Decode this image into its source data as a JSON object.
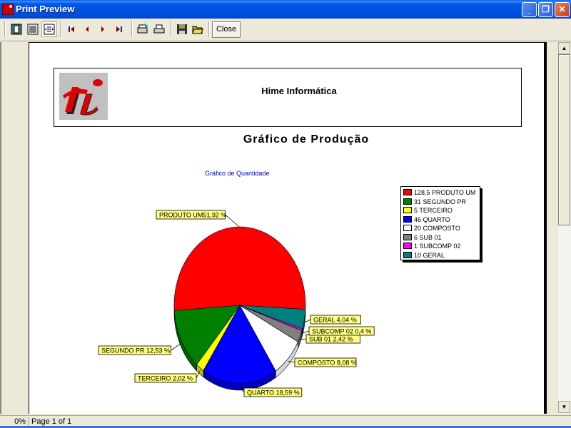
{
  "window": {
    "title": "Print Preview",
    "controls": [
      "minimize",
      "restore",
      "close"
    ]
  },
  "toolbar": {
    "buttons": [
      {
        "name": "whole-page",
        "icon": "whole-page-icon"
      },
      {
        "name": "page-width",
        "icon": "page-width-icon"
      },
      {
        "name": "zoom-100",
        "icon": "zoom-100-icon",
        "pressed": true
      },
      {
        "name": "first-page",
        "icon": "first-page-icon"
      },
      {
        "name": "prior-page",
        "icon": "prior-page-icon"
      },
      {
        "name": "next-page",
        "icon": "next-page-icon"
      },
      {
        "name": "last-page",
        "icon": "last-page-icon"
      },
      {
        "name": "printer-setup",
        "icon": "printer-setup-icon"
      },
      {
        "name": "print",
        "icon": "print-icon"
      },
      {
        "name": "save",
        "icon": "save-icon"
      },
      {
        "name": "open",
        "icon": "open-folder-icon"
      }
    ],
    "close_label": "Close"
  },
  "report": {
    "company": "Hime Informática",
    "title": "Gráfico de Produção"
  },
  "chart_data": {
    "type": "pie",
    "title": "Gráfico de Quantidade",
    "legend_position": "top-right",
    "slices": [
      {
        "name": "PRODUTO UM",
        "value": 128.5,
        "percent": 51.92,
        "label": "PRODUTO UM51,92 %",
        "legend": "128,5 PRODUTO UM",
        "color": "#ff0000"
      },
      {
        "name": "SEGUNDO PR",
        "value": 31,
        "percent": 12.53,
        "label": "SEGUNDO PR 12,53 %",
        "legend": "31 SEGUNDO PR",
        "color": "#008000"
      },
      {
        "name": "TERCEIRO",
        "value": 5,
        "percent": 2.02,
        "label": "TERCEIRO 2,02 %",
        "legend": "5 TERCEIRO",
        "color": "#ffff00"
      },
      {
        "name": "QUARTO",
        "value": 46,
        "percent": 18.59,
        "label": "QUARTO 18,59 %",
        "legend": "46 QUARTO",
        "color": "#0000ff"
      },
      {
        "name": "COMPOSTO",
        "value": 20,
        "percent": 8.08,
        "label": "COMPOSTO 8,08 %",
        "legend": "20 COMPOSTO",
        "color": "#ffffff"
      },
      {
        "name": "SUB 01",
        "value": 6,
        "percent": 2.42,
        "label": "SUB 01 2,42 %",
        "legend": "6 SUB 01",
        "color": "#808080"
      },
      {
        "name": "SUBCOMP 02",
        "value": 1,
        "percent": 0.4,
        "label": "SUBCOMP 02 0,4 %",
        "legend": "1 SUBCOMP 02",
        "color": "#ff00ff"
      },
      {
        "name": "GERAL",
        "value": 10,
        "percent": 4.04,
        "label": "GERAL 4,04 %",
        "legend": "10 GERAL",
        "color": "#008080"
      }
    ]
  },
  "status": {
    "progress": "0%",
    "page_info": "Page 1 of 1"
  }
}
